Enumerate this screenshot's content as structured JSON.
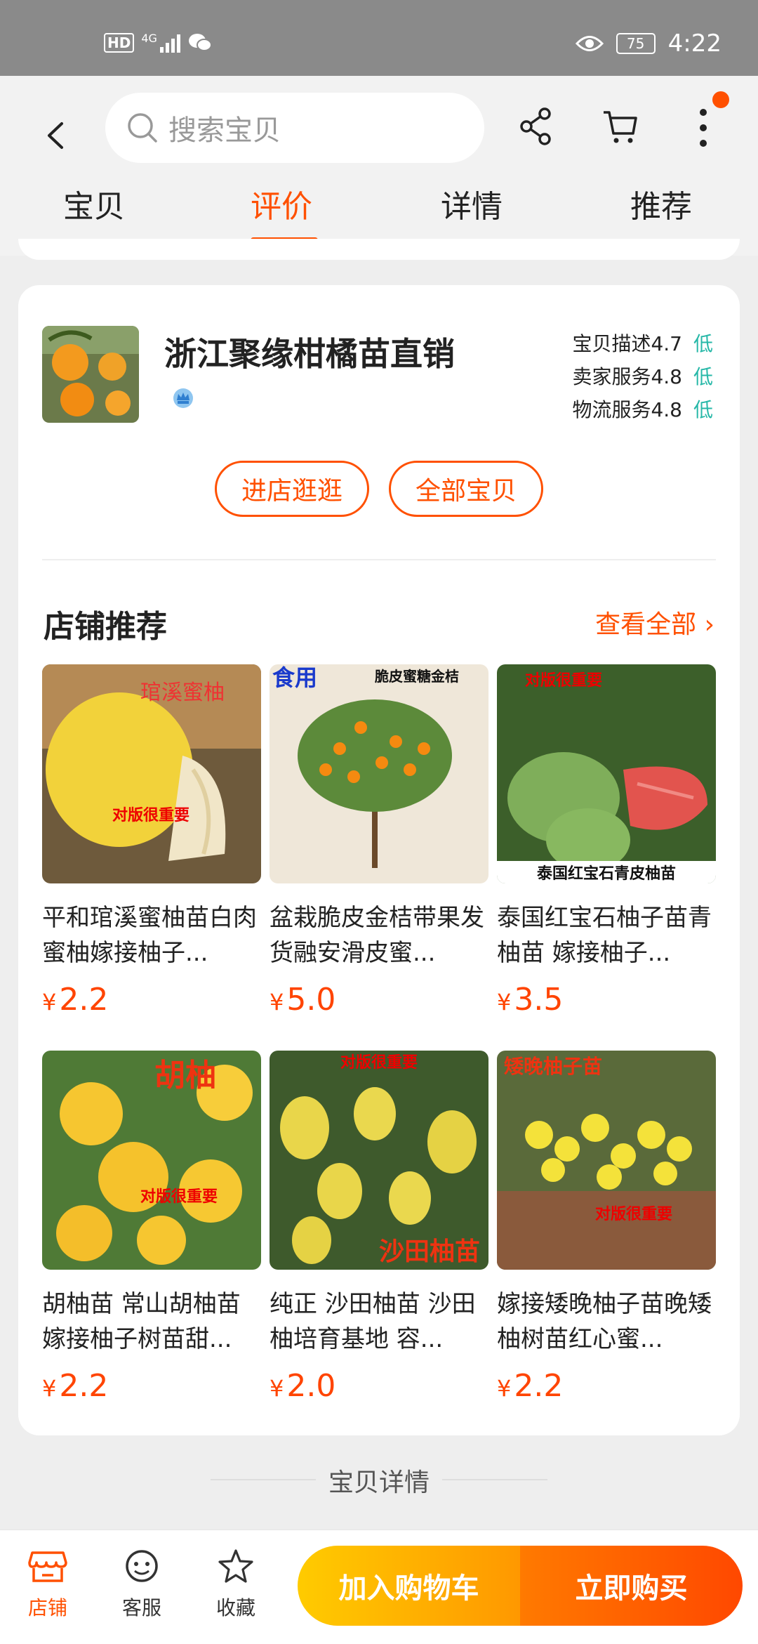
{
  "status": {
    "network": "4G",
    "hd": "HD",
    "battery": "75",
    "time": "4:22"
  },
  "header": {
    "search_placeholder": "搜索宝贝"
  },
  "tabs": [
    "宝贝",
    "评价",
    "详情",
    "推荐"
  ],
  "shop": {
    "name": "浙江聚缘柑橘苗直销",
    "ratings": [
      {
        "label": "宝贝描述",
        "score": "4.7",
        "level": "低"
      },
      {
        "label": "卖家服务",
        "score": "4.8",
        "level": "低"
      },
      {
        "label": "物流服务",
        "score": "4.8",
        "level": "低"
      }
    ],
    "enter_store": "进店逛逛",
    "all_items": "全部宝贝"
  },
  "recommend": {
    "title": "店铺推荐",
    "more": "查看全部",
    "currency": "¥",
    "products": [
      {
        "title": "平和琯溪蜜柚苗白肉蜜柚嫁接柚子...",
        "price": "2.2",
        "img_text": "琯溪蜜柚",
        "img_note": "对版很重要"
      },
      {
        "title": "盆栽脆皮金桔带果发货融安滑皮蜜...",
        "price": "5.0",
        "img_text": "食用",
        "img_note": "脆皮蜜糖金桔"
      },
      {
        "title": "泰国红宝石柚子苗青柚苗 嫁接柚子...",
        "price": "3.5",
        "img_text": "泰国红宝石青皮柚苗",
        "img_note": "对版很重要"
      },
      {
        "title": "胡柚苗 常山胡柚苗嫁接柚子树苗甜...",
        "price": "2.2",
        "img_text": "胡柚",
        "img_note": "对版很重要"
      },
      {
        "title": "纯正 沙田柚苗 沙田柚培育基地 容...",
        "price": "2.0",
        "img_text": "沙田柚苗",
        "img_note": "对版很重要"
      },
      {
        "title": "嫁接矮晚柚子苗晚矮柚树苗红心蜜...",
        "price": "2.2",
        "img_text": "矮晚柚子苗",
        "img_note": "对版很重要"
      }
    ]
  },
  "detail_section": "宝贝详情",
  "bottom": {
    "store": "店铺",
    "service": "客服",
    "favorite": "收藏",
    "add_cart": "加入购物车",
    "buy_now": "立即购买"
  },
  "colors": {
    "accent": "#ff5000",
    "price": "#ff4400",
    "rating_level": "#27b8a8"
  }
}
